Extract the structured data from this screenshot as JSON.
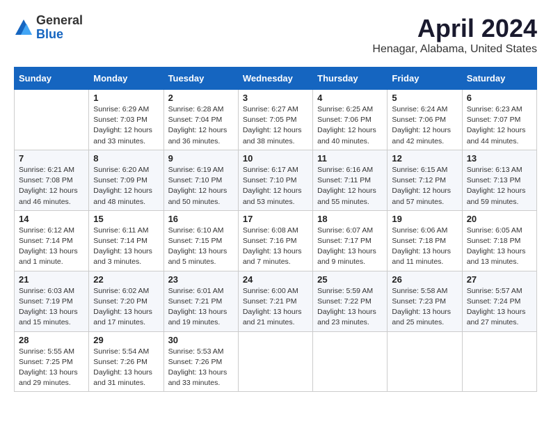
{
  "header": {
    "logo_general": "General",
    "logo_blue": "Blue",
    "month": "April 2024",
    "location": "Henagar, Alabama, United States"
  },
  "days_of_week": [
    "Sunday",
    "Monday",
    "Tuesday",
    "Wednesday",
    "Thursday",
    "Friday",
    "Saturday"
  ],
  "weeks": [
    [
      {
        "day": "",
        "sunrise": "",
        "sunset": "",
        "daylight": ""
      },
      {
        "day": "1",
        "sunrise": "Sunrise: 6:29 AM",
        "sunset": "Sunset: 7:03 PM",
        "daylight": "Daylight: 12 hours and 33 minutes."
      },
      {
        "day": "2",
        "sunrise": "Sunrise: 6:28 AM",
        "sunset": "Sunset: 7:04 PM",
        "daylight": "Daylight: 12 hours and 36 minutes."
      },
      {
        "day": "3",
        "sunrise": "Sunrise: 6:27 AM",
        "sunset": "Sunset: 7:05 PM",
        "daylight": "Daylight: 12 hours and 38 minutes."
      },
      {
        "day": "4",
        "sunrise": "Sunrise: 6:25 AM",
        "sunset": "Sunset: 7:06 PM",
        "daylight": "Daylight: 12 hours and 40 minutes."
      },
      {
        "day": "5",
        "sunrise": "Sunrise: 6:24 AM",
        "sunset": "Sunset: 7:06 PM",
        "daylight": "Daylight: 12 hours and 42 minutes."
      },
      {
        "day": "6",
        "sunrise": "Sunrise: 6:23 AM",
        "sunset": "Sunset: 7:07 PM",
        "daylight": "Daylight: 12 hours and 44 minutes."
      }
    ],
    [
      {
        "day": "7",
        "sunrise": "Sunrise: 6:21 AM",
        "sunset": "Sunset: 7:08 PM",
        "daylight": "Daylight: 12 hours and 46 minutes."
      },
      {
        "day": "8",
        "sunrise": "Sunrise: 6:20 AM",
        "sunset": "Sunset: 7:09 PM",
        "daylight": "Daylight: 12 hours and 48 minutes."
      },
      {
        "day": "9",
        "sunrise": "Sunrise: 6:19 AM",
        "sunset": "Sunset: 7:10 PM",
        "daylight": "Daylight: 12 hours and 50 minutes."
      },
      {
        "day": "10",
        "sunrise": "Sunrise: 6:17 AM",
        "sunset": "Sunset: 7:10 PM",
        "daylight": "Daylight: 12 hours and 53 minutes."
      },
      {
        "day": "11",
        "sunrise": "Sunrise: 6:16 AM",
        "sunset": "Sunset: 7:11 PM",
        "daylight": "Daylight: 12 hours and 55 minutes."
      },
      {
        "day": "12",
        "sunrise": "Sunrise: 6:15 AM",
        "sunset": "Sunset: 7:12 PM",
        "daylight": "Daylight: 12 hours and 57 minutes."
      },
      {
        "day": "13",
        "sunrise": "Sunrise: 6:13 AM",
        "sunset": "Sunset: 7:13 PM",
        "daylight": "Daylight: 12 hours and 59 minutes."
      }
    ],
    [
      {
        "day": "14",
        "sunrise": "Sunrise: 6:12 AM",
        "sunset": "Sunset: 7:14 PM",
        "daylight": "Daylight: 13 hours and 1 minute."
      },
      {
        "day": "15",
        "sunrise": "Sunrise: 6:11 AM",
        "sunset": "Sunset: 7:14 PM",
        "daylight": "Daylight: 13 hours and 3 minutes."
      },
      {
        "day": "16",
        "sunrise": "Sunrise: 6:10 AM",
        "sunset": "Sunset: 7:15 PM",
        "daylight": "Daylight: 13 hours and 5 minutes."
      },
      {
        "day": "17",
        "sunrise": "Sunrise: 6:08 AM",
        "sunset": "Sunset: 7:16 PM",
        "daylight": "Daylight: 13 hours and 7 minutes."
      },
      {
        "day": "18",
        "sunrise": "Sunrise: 6:07 AM",
        "sunset": "Sunset: 7:17 PM",
        "daylight": "Daylight: 13 hours and 9 minutes."
      },
      {
        "day": "19",
        "sunrise": "Sunrise: 6:06 AM",
        "sunset": "Sunset: 7:18 PM",
        "daylight": "Daylight: 13 hours and 11 minutes."
      },
      {
        "day": "20",
        "sunrise": "Sunrise: 6:05 AM",
        "sunset": "Sunset: 7:18 PM",
        "daylight": "Daylight: 13 hours and 13 minutes."
      }
    ],
    [
      {
        "day": "21",
        "sunrise": "Sunrise: 6:03 AM",
        "sunset": "Sunset: 7:19 PM",
        "daylight": "Daylight: 13 hours and 15 minutes."
      },
      {
        "day": "22",
        "sunrise": "Sunrise: 6:02 AM",
        "sunset": "Sunset: 7:20 PM",
        "daylight": "Daylight: 13 hours and 17 minutes."
      },
      {
        "day": "23",
        "sunrise": "Sunrise: 6:01 AM",
        "sunset": "Sunset: 7:21 PM",
        "daylight": "Daylight: 13 hours and 19 minutes."
      },
      {
        "day": "24",
        "sunrise": "Sunrise: 6:00 AM",
        "sunset": "Sunset: 7:21 PM",
        "daylight": "Daylight: 13 hours and 21 minutes."
      },
      {
        "day": "25",
        "sunrise": "Sunrise: 5:59 AM",
        "sunset": "Sunset: 7:22 PM",
        "daylight": "Daylight: 13 hours and 23 minutes."
      },
      {
        "day": "26",
        "sunrise": "Sunrise: 5:58 AM",
        "sunset": "Sunset: 7:23 PM",
        "daylight": "Daylight: 13 hours and 25 minutes."
      },
      {
        "day": "27",
        "sunrise": "Sunrise: 5:57 AM",
        "sunset": "Sunset: 7:24 PM",
        "daylight": "Daylight: 13 hours and 27 minutes."
      }
    ],
    [
      {
        "day": "28",
        "sunrise": "Sunrise: 5:55 AM",
        "sunset": "Sunset: 7:25 PM",
        "daylight": "Daylight: 13 hours and 29 minutes."
      },
      {
        "day": "29",
        "sunrise": "Sunrise: 5:54 AM",
        "sunset": "Sunset: 7:26 PM",
        "daylight": "Daylight: 13 hours and 31 minutes."
      },
      {
        "day": "30",
        "sunrise": "Sunrise: 5:53 AM",
        "sunset": "Sunset: 7:26 PM",
        "daylight": "Daylight: 13 hours and 33 minutes."
      },
      {
        "day": "",
        "sunrise": "",
        "sunset": "",
        "daylight": ""
      },
      {
        "day": "",
        "sunrise": "",
        "sunset": "",
        "daylight": ""
      },
      {
        "day": "",
        "sunrise": "",
        "sunset": "",
        "daylight": ""
      },
      {
        "day": "",
        "sunrise": "",
        "sunset": "",
        "daylight": ""
      }
    ]
  ]
}
